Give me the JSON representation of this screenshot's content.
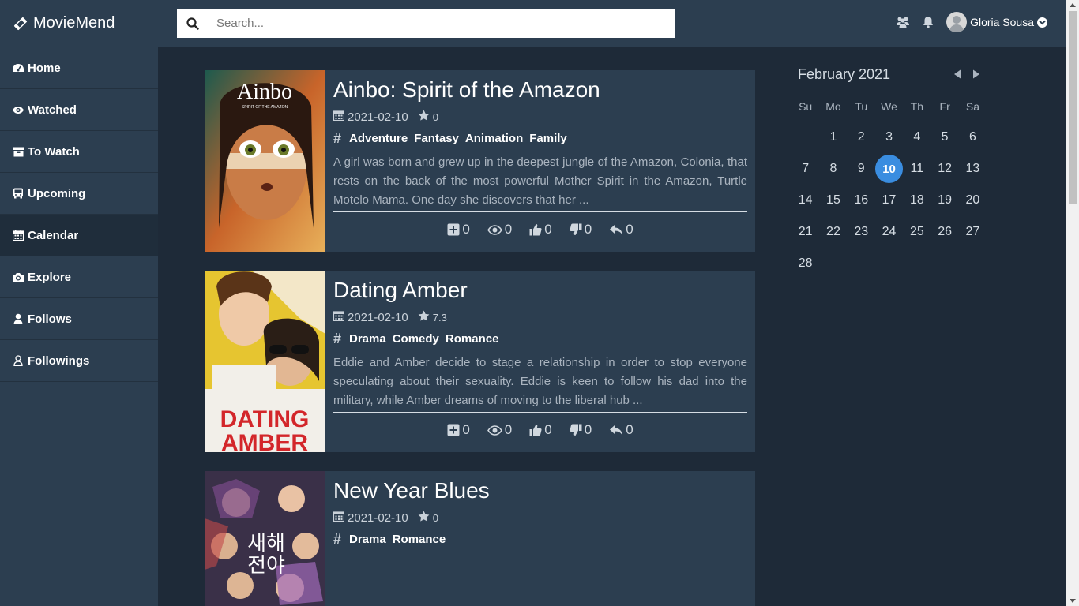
{
  "app": {
    "name": "MovieMend"
  },
  "search": {
    "placeholder": "Search..."
  },
  "user": {
    "name": "Gloria Sousa"
  },
  "sidebar": {
    "items": [
      {
        "label": "Home",
        "icon": "dashboard-icon"
      },
      {
        "label": "Watched",
        "icon": "eye-icon"
      },
      {
        "label": "To Watch",
        "icon": "archive-icon"
      },
      {
        "label": "Upcoming",
        "icon": "bus-icon"
      },
      {
        "label": "Calendar",
        "icon": "calendar-icon",
        "active": true
      },
      {
        "label": "Explore",
        "icon": "camera-icon"
      },
      {
        "label": "Follows",
        "icon": "user-icon"
      },
      {
        "label": "Followings",
        "icon": "user-outline-icon"
      }
    ]
  },
  "movies": [
    {
      "title": "Ainbo: Spirit of the Amazon",
      "date": "2021-02-10",
      "rating": "0",
      "genres": [
        "Adventure",
        "Fantasy",
        "Animation",
        "Family"
      ],
      "overview": "A girl was born and grew up in the deepest jungle of the Amazon, Colonia, that rests on the back of the most powerful Mother Spirit in the Amazon, Turtle Motelo Mama. One day she discovers that her ...",
      "stats": {
        "add": "0",
        "watched": "0",
        "likes": "0",
        "dislikes": "0",
        "replies": "0"
      },
      "poster_text": "Ainbo",
      "poster_sub": "SPIRIT OF THE AMAZON"
    },
    {
      "title": "Dating Amber",
      "date": "2021-02-10",
      "rating": "7.3",
      "genres": [
        "Drama",
        "Comedy",
        "Romance"
      ],
      "overview": "Eddie and Amber decide to stage a relationship in order to stop everyone speculating about their sexuality. Eddie is keen to follow his dad into the military, while Amber dreams of moving to the liberal hub ...",
      "stats": {
        "add": "0",
        "watched": "0",
        "likes": "0",
        "dislikes": "0",
        "replies": "0"
      },
      "poster_text": "DATING AMBER"
    },
    {
      "title": "New Year Blues",
      "date": "2021-02-10",
      "rating": "0",
      "genres": [
        "Drama",
        "Romance"
      ],
      "poster_text": "새해전야"
    }
  ],
  "calendar": {
    "month_label": "February 2021",
    "weekdays": [
      "Su",
      "Mo",
      "Tu",
      "We",
      "Th",
      "Fr",
      "Sa"
    ],
    "leading_blanks": 1,
    "days": [
      "1",
      "2",
      "3",
      "4",
      "5",
      "6",
      "7",
      "8",
      "9",
      "10",
      "11",
      "12",
      "13",
      "14",
      "15",
      "16",
      "17",
      "18",
      "19",
      "20",
      "21",
      "22",
      "23",
      "24",
      "25",
      "26",
      "27",
      "28"
    ],
    "today": "10"
  },
  "colors": {
    "accent": "#3a8de0",
    "topbar": "#2c3e50",
    "background": "#1e2a38",
    "card": "#2c3e50"
  }
}
